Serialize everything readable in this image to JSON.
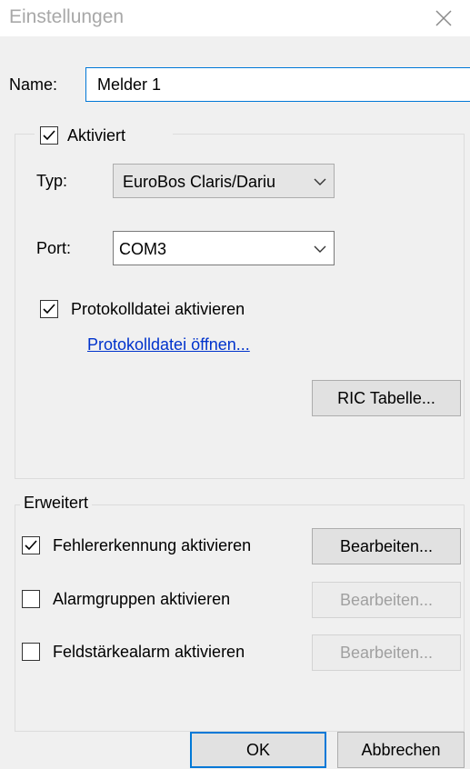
{
  "window": {
    "title": "Einstellungen",
    "close_icon": "close-icon"
  },
  "name_field": {
    "label": "Name:",
    "value": "Melder 1"
  },
  "group_aktiviert": {
    "checkbox_label": "Aktiviert",
    "checked": true,
    "typ_label": "Typ:",
    "typ_value": "EuroBos Claris/Dariu",
    "port_label": "Port:",
    "port_value": "COM3",
    "protokoll_label": "Protokolldatei aktivieren",
    "protokoll_checked": true,
    "protokoll_link": "Protokolldatei öffnen...",
    "ric_button": "RIC Tabelle..."
  },
  "group_erweitert": {
    "legend": "Erweitert",
    "rows": [
      {
        "label": "Fehlererkennung aktivieren",
        "checked": true,
        "button": "Bearbeiten...",
        "button_enabled": true
      },
      {
        "label": "Alarmgruppen aktivieren",
        "checked": false,
        "button": "Bearbeiten...",
        "button_enabled": false
      },
      {
        "label": "Feldstärkealarm aktivieren",
        "checked": false,
        "button": "Bearbeiten...",
        "button_enabled": false
      }
    ]
  },
  "footer": {
    "ok": "OK",
    "cancel": "Abbrechen"
  }
}
